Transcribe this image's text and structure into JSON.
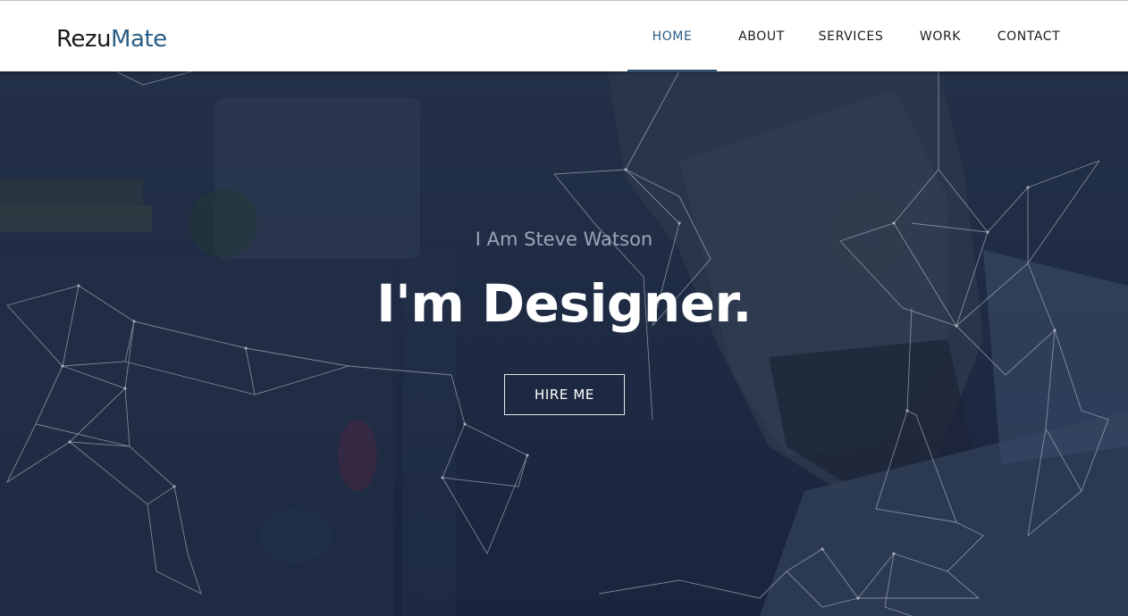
{
  "brand": {
    "part1": "Rezu",
    "part2": "Mate"
  },
  "nav": {
    "items": [
      {
        "label": "HOME",
        "active": true
      },
      {
        "label": "ABOUT",
        "active": false
      },
      {
        "label": "SERVICES",
        "active": false
      },
      {
        "label": "WORK",
        "active": false
      },
      {
        "label": "CONTACT",
        "active": false
      }
    ]
  },
  "hero": {
    "intro": "I Am Steve Watson",
    "headline": "I'm Designer.",
    "cta_label": "HIRE ME"
  },
  "colors": {
    "accent": "#2a5d85",
    "overlay": "#1e2a40"
  }
}
